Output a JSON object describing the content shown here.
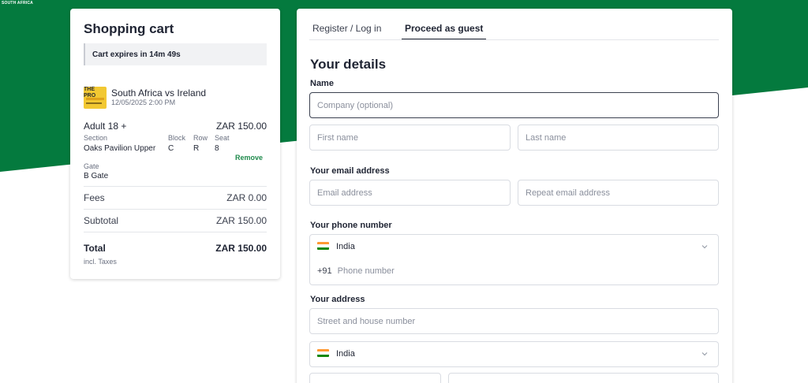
{
  "brand": {
    "tag": "SOUTH AFRICA"
  },
  "colors": {
    "brand_green": "#047a3e",
    "accent_green": "#1f8a4c"
  },
  "cart": {
    "title": "Shopping cart",
    "expiry": "Cart expires in 14m 49s",
    "event": {
      "name": "South Africa vs Ireland",
      "date": "12/05/2025 2:00 PM",
      "thumb_text": "THE PRO",
      "thumb_icon": "event-poster-image"
    },
    "ticket": {
      "type": "Adult 18 +",
      "price": "ZAR 150.00",
      "section_label": "Section",
      "section_value": "Oaks Pavilion Upper",
      "block_label": "Block",
      "block_value": "C",
      "row_label": "Row",
      "row_value": "R",
      "seat_label": "Seat",
      "seat_value": "8",
      "remove": "Remove",
      "gate_label": "Gate",
      "gate_value": "B Gate"
    },
    "fees_label": "Fees",
    "fees_value": "ZAR 0.00",
    "subtotal_label": "Subtotal",
    "subtotal_value": "ZAR 150.00",
    "total_label": "Total",
    "total_value": "ZAR 150.00",
    "total_note": "incl. Taxes"
  },
  "form": {
    "tabs": [
      {
        "label": "Register / Log in",
        "active": false
      },
      {
        "label": "Proceed as guest",
        "active": true
      }
    ],
    "title": "Your details",
    "name_label": "Name",
    "company_placeholder": "Company (optional)",
    "first_name_placeholder": "First name",
    "last_name_placeholder": "Last name",
    "email_label": "Your email address",
    "email_placeholder": "Email address",
    "repeat_email_placeholder": "Repeat email address",
    "phone_label": "Your phone number",
    "phone_country": "India",
    "phone_prefix": "+91",
    "phone_placeholder": "Phone number",
    "address_label": "Your address",
    "street_placeholder": "Street and house number",
    "address_country": "India",
    "flag_icon": "india-flag-icon",
    "dropdown_icon": "chevron-down-icon"
  }
}
